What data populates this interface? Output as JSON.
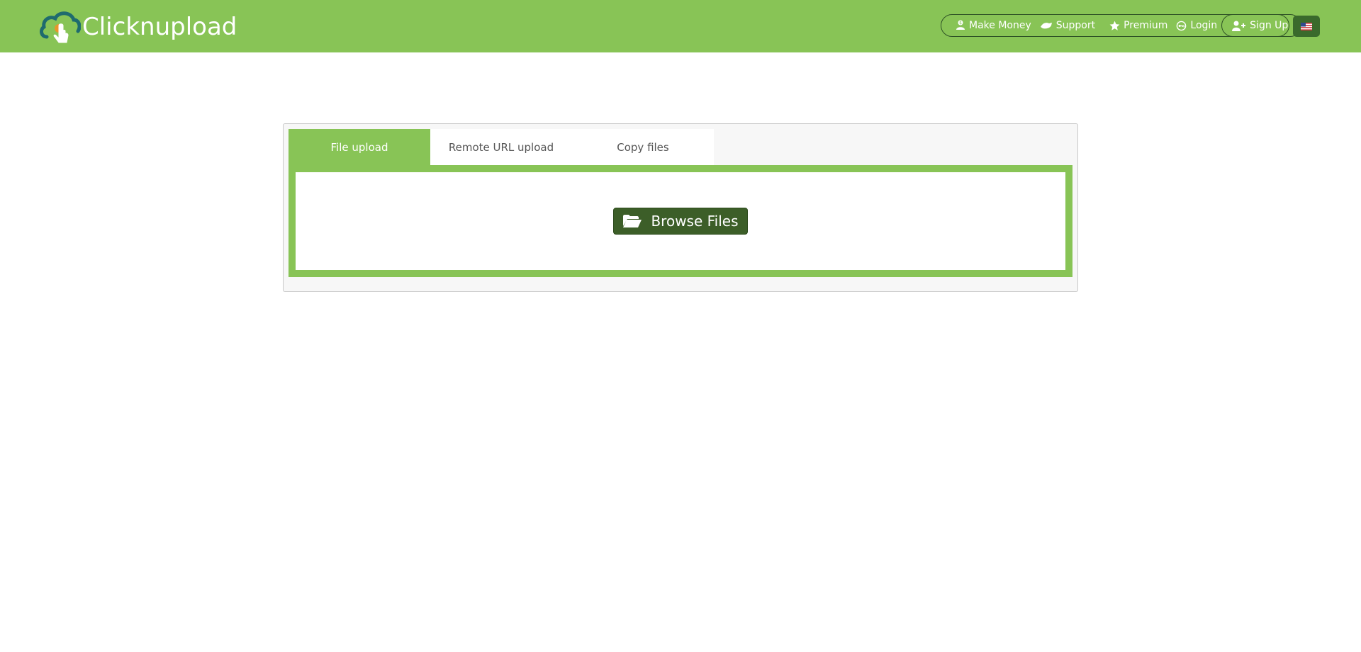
{
  "brand": {
    "name": "Clicknupload",
    "colors": {
      "header": "#88c456",
      "dark": "#3c5e28",
      "border": "#2e5226"
    }
  },
  "nav": {
    "items": [
      {
        "label": "Make Money",
        "icon": "money-icon"
      },
      {
        "label": "Support",
        "icon": "support-icon"
      },
      {
        "label": "Premium",
        "icon": "star-icon"
      },
      {
        "label": "Login",
        "icon": "key-icon"
      },
      {
        "label": "Sign Up",
        "icon": "user-plus-icon"
      }
    ],
    "language_icon": "us-flag-icon"
  },
  "upload": {
    "tabs": [
      {
        "label": "File upload",
        "active": true
      },
      {
        "label": "Remote URL upload",
        "active": false
      },
      {
        "label": "Copy files",
        "active": false
      }
    ],
    "browse_label": "Browse Files",
    "browse_icon": "folder-open-icon"
  }
}
